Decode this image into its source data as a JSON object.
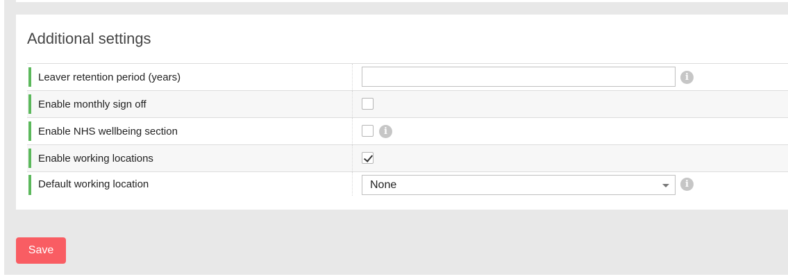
{
  "section": {
    "title": "Additional settings"
  },
  "settings": [
    {
      "label": "Leaver retention period (years)",
      "control": "text",
      "value": "",
      "has_info": true
    },
    {
      "label": "Enable monthly sign off",
      "control": "checkbox",
      "checked": false,
      "has_info": false
    },
    {
      "label": "Enable NHS wellbeing section",
      "control": "checkbox",
      "checked": false,
      "has_info": true
    },
    {
      "label": "Enable working locations",
      "control": "checkbox",
      "checked": true,
      "has_info": false
    },
    {
      "label": "Default working location",
      "control": "select",
      "value": "None",
      "has_info": true
    }
  ],
  "actions": {
    "save_label": "Save"
  },
  "colors": {
    "accent_bar": "#5cb85c",
    "save_button": "#f95d63",
    "info_icon": "#c6c6c6"
  },
  "icons": {
    "info": "info-icon",
    "checkmark": "checkmark-icon",
    "dropdown": "chevron-down-icon"
  }
}
